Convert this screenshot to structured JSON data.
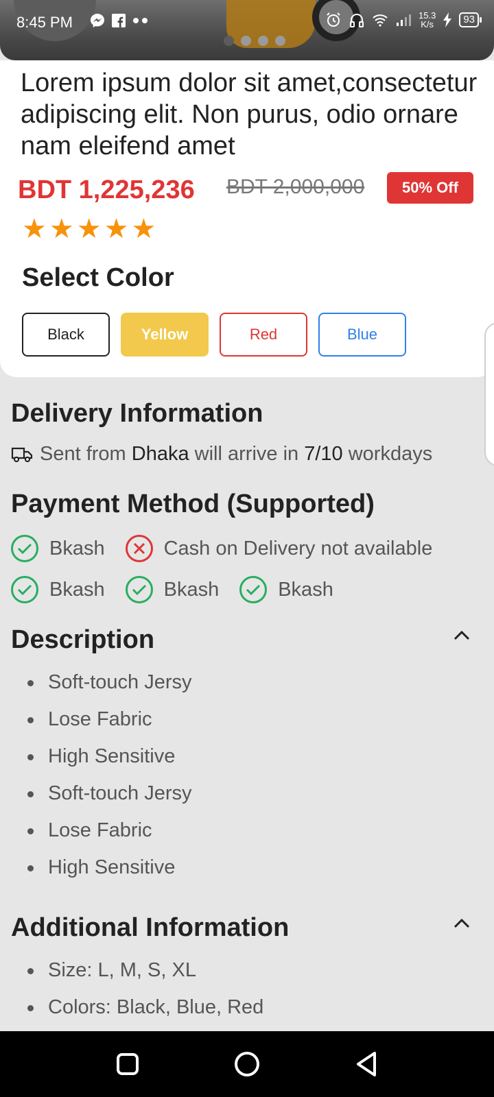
{
  "status_bar": {
    "time": "8:45 PM",
    "speed_top": "15.3",
    "speed_bottom": "K/s",
    "battery": "93"
  },
  "carousel": {
    "pages": 4,
    "active": 0
  },
  "product": {
    "title": "Lorem ipsum dolor sit amet,consectetur adipiscing elit. Non purus, odio ornare nam eleifend amet",
    "price": "BDT 1,225,236",
    "old_price": "BDT 2,000,000",
    "discount_badge": "50% Off",
    "rating": 5,
    "stars": [
      "★",
      "★",
      "★",
      "★",
      "★"
    ]
  },
  "color_select": {
    "label": "Select Color",
    "options": [
      "Black",
      "Yellow",
      "Red",
      "Blue"
    ],
    "selected": "Yellow"
  },
  "delivery": {
    "heading": "Delivery Information",
    "prefix": "Sent from",
    "city": "Dhaka",
    "middle": "will arrive in",
    "days": "7/10",
    "suffix": "workdays"
  },
  "payment": {
    "heading": "Payment Method (Supported)",
    "methods": [
      {
        "label": "Bkash",
        "available": true
      },
      {
        "label": "Cash on Delivery not available",
        "available": false
      },
      {
        "label": "Bkash",
        "available": true
      },
      {
        "label": "Bkash",
        "available": true
      },
      {
        "label": "Bkash",
        "available": true
      }
    ]
  },
  "description": {
    "heading": "Description",
    "items": [
      "Soft-touch Jersy",
      "Lose Fabric",
      "High Sensitive",
      "Soft-touch Jersy",
      "Lose Fabric",
      "High Sensitive"
    ]
  },
  "additional": {
    "heading": "Additional Information",
    "items": [
      "Size:  L, M, S, XL",
      "Colors: Black, Blue, Red"
    ]
  },
  "colors": {
    "price_red": "#e03535",
    "star_orange": "#f7920b",
    "check_green": "#27ae60",
    "yellow": "#f2c94c",
    "blue": "#2f80ed"
  }
}
